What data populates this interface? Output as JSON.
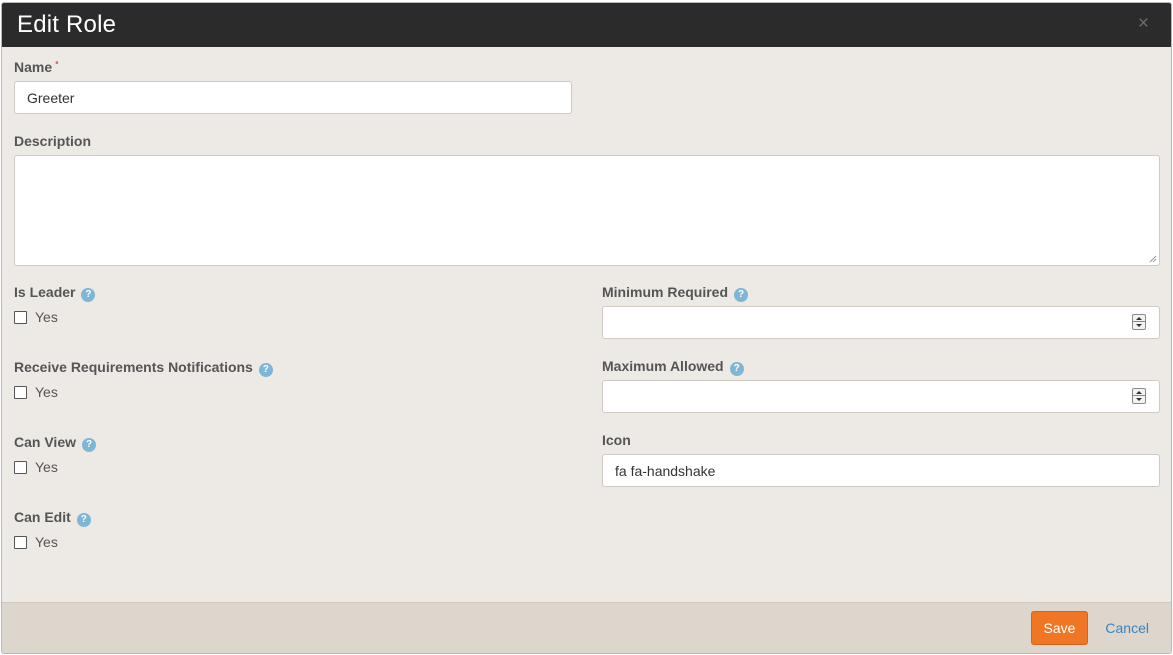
{
  "dialog": {
    "title": "Edit Role",
    "close": "×"
  },
  "form": {
    "name": {
      "label": "Name",
      "required_mark": "•",
      "value": "Greeter"
    },
    "description": {
      "label": "Description",
      "value": ""
    },
    "is_leader": {
      "label": "Is Leader",
      "option": "Yes",
      "checked": false
    },
    "receive_notifications": {
      "label": "Receive Requirements Notifications",
      "option": "Yes",
      "checked": false
    },
    "can_view": {
      "label": "Can View",
      "option": "Yes",
      "checked": false
    },
    "can_edit": {
      "label": "Can Edit",
      "option": "Yes",
      "checked": false
    },
    "minimum_required": {
      "label": "Minimum Required",
      "value": ""
    },
    "maximum_allowed": {
      "label": "Maximum Allowed",
      "value": ""
    },
    "icon": {
      "label": "Icon",
      "value": "fa fa-handshake"
    },
    "help_glyph": "?"
  },
  "footer": {
    "save_label": "Save",
    "cancel_label": "Cancel"
  },
  "colors": {
    "header_bg": "#2b2b2b",
    "body_bg": "#edeae6",
    "footer_bg": "#ddd6cd",
    "primary_button": "#ee7625",
    "link": "#3b83c0",
    "help_icon": "#7eb6d6",
    "required_mark": "#e86c5f"
  }
}
